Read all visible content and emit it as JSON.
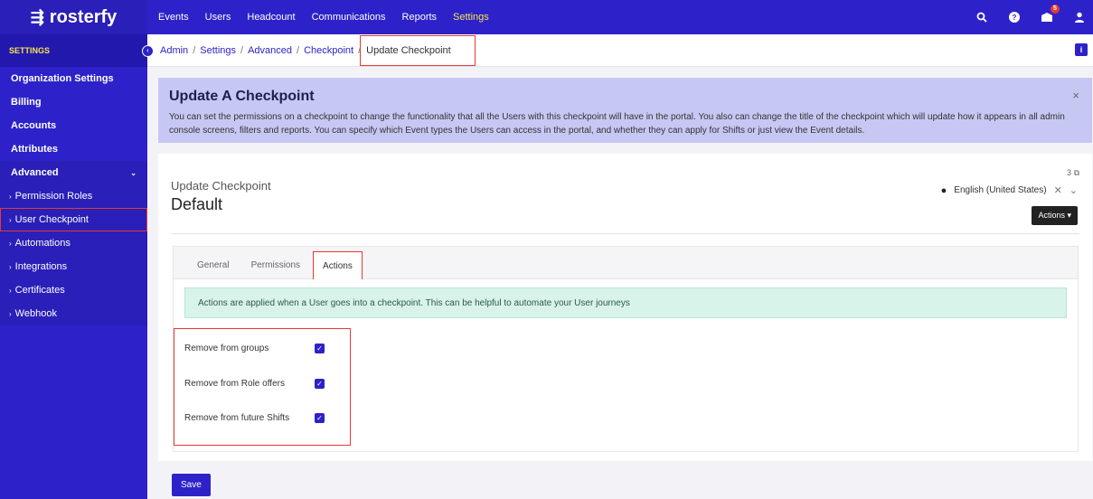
{
  "app": {
    "logo_text": "rosterfy"
  },
  "topnav": {
    "items": [
      "Events",
      "Users",
      "Headcount",
      "Communications",
      "Reports",
      "Settings"
    ],
    "active": "Settings",
    "notification_count": "5"
  },
  "sidebar": {
    "heading": "SETTINGS",
    "items": [
      "Organization Settings",
      "Billing",
      "Accounts",
      "Attributes"
    ],
    "section": "Advanced",
    "sub_items": [
      "Permission Roles",
      "User Checkpoint",
      "Automations",
      "Integrations",
      "Certificates",
      "Webhook"
    ]
  },
  "breadcrumb": {
    "links": [
      "Admin",
      "Settings",
      "Advanced",
      "Checkpoint"
    ],
    "current": "Update Checkpoint",
    "sep": "/"
  },
  "banner": {
    "title": "Update A Checkpoint",
    "text": "You can set the permissions on a checkpoint to change the functionality that all the Users with this checkpoint will have in the portal. You also can change the title of the checkpoint which will update how it appears in all admin console screens, filters and reports. You can specify which Event types the Users can access in the portal, and whether they can apply for Shifts or just view the Event details.",
    "close": "×"
  },
  "card": {
    "subtitle": "Update Checkpoint",
    "title": "Default",
    "counter": "3",
    "language": "English (United States)",
    "actions_label": "Actions ▾"
  },
  "tabs": [
    "General",
    "Permissions",
    "Actions"
  ],
  "active_tab": "Actions",
  "alert": "Actions are applied when a User goes into a checkpoint. This can be helpful to automate your User journeys",
  "checkboxes": [
    {
      "label": "Remove from groups",
      "checked": true
    },
    {
      "label": "Remove from Role offers",
      "checked": true
    },
    {
      "label": "Remove from future Shifts",
      "checked": true
    }
  ],
  "save_label": "Save",
  "colors": {
    "brand": "#2d22c9",
    "highlight": "#e53935",
    "active_nav": "#f5e44b"
  }
}
